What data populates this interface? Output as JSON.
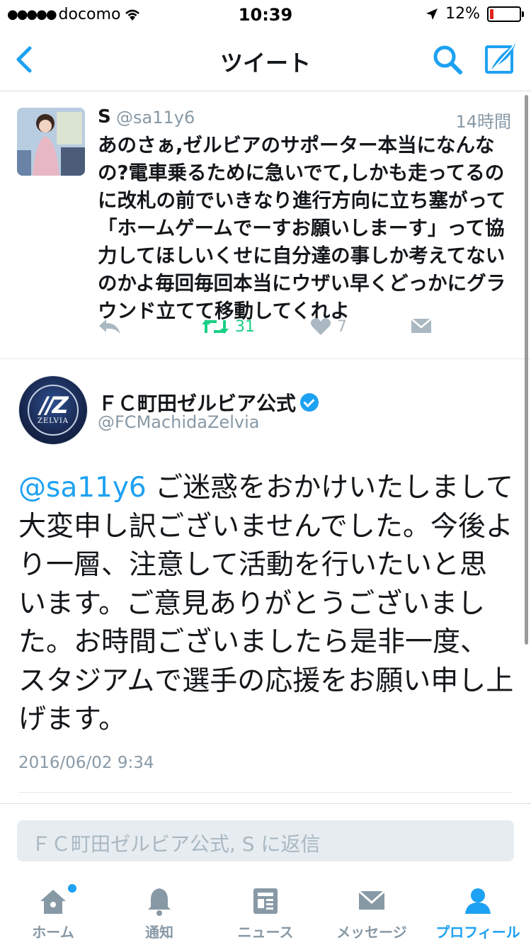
{
  "status_bar": {
    "signal_dots": "●●●●●",
    "carrier": "docomo",
    "time": "10:39",
    "battery_percent_text": "12%",
    "battery_level": 0.12
  },
  "nav": {
    "title": "ツイート",
    "accent_color": "#1da1f2"
  },
  "quoted_tweet": {
    "name": "S",
    "handle": "@sa11y6",
    "time": "14時間",
    "text": "あのさぁ,ゼルビアのサポーター本当になんなの?電車乗るために急いでて,しかも走ってるのに改札の前でいきなり進行方向に立ち塞がって「ホームゲームでーすお願いしまーす」って協力してほしいくせに自分達の事しか考えてないのかよ毎回毎回本当にウザい早くどっかにグラウンド立てて移動してくれよ",
    "retweet_count": "31",
    "like_count": "7"
  },
  "main_tweet": {
    "name": "ＦＣ町田ゼルビア公式",
    "handle": "@FCMachidaZelvia",
    "mention": "@sa11y6",
    "text": " ご迷惑をおかけいたしまして大変申し訳ございませんでした。今後より一層、注意して活動を行いたいと思います。ご意見ありがとうございました。お時間ございましたら是非一度、スタジアムで選手の応援をお願い申し上げます。",
    "date": "2016/06/02 9:34",
    "avatar_logo": "ZELVIA"
  },
  "reply": {
    "placeholder": "ＦＣ町田ゼルビア公式, S に返信"
  },
  "tabs": [
    {
      "label": "ホーム",
      "icon": "home-icon"
    },
    {
      "label": "通知",
      "icon": "bell-icon"
    },
    {
      "label": "ニュース",
      "icon": "news-icon"
    },
    {
      "label": "メッセージ",
      "icon": "envelope-icon"
    },
    {
      "label": "プロフィール",
      "icon": "person-icon"
    }
  ]
}
